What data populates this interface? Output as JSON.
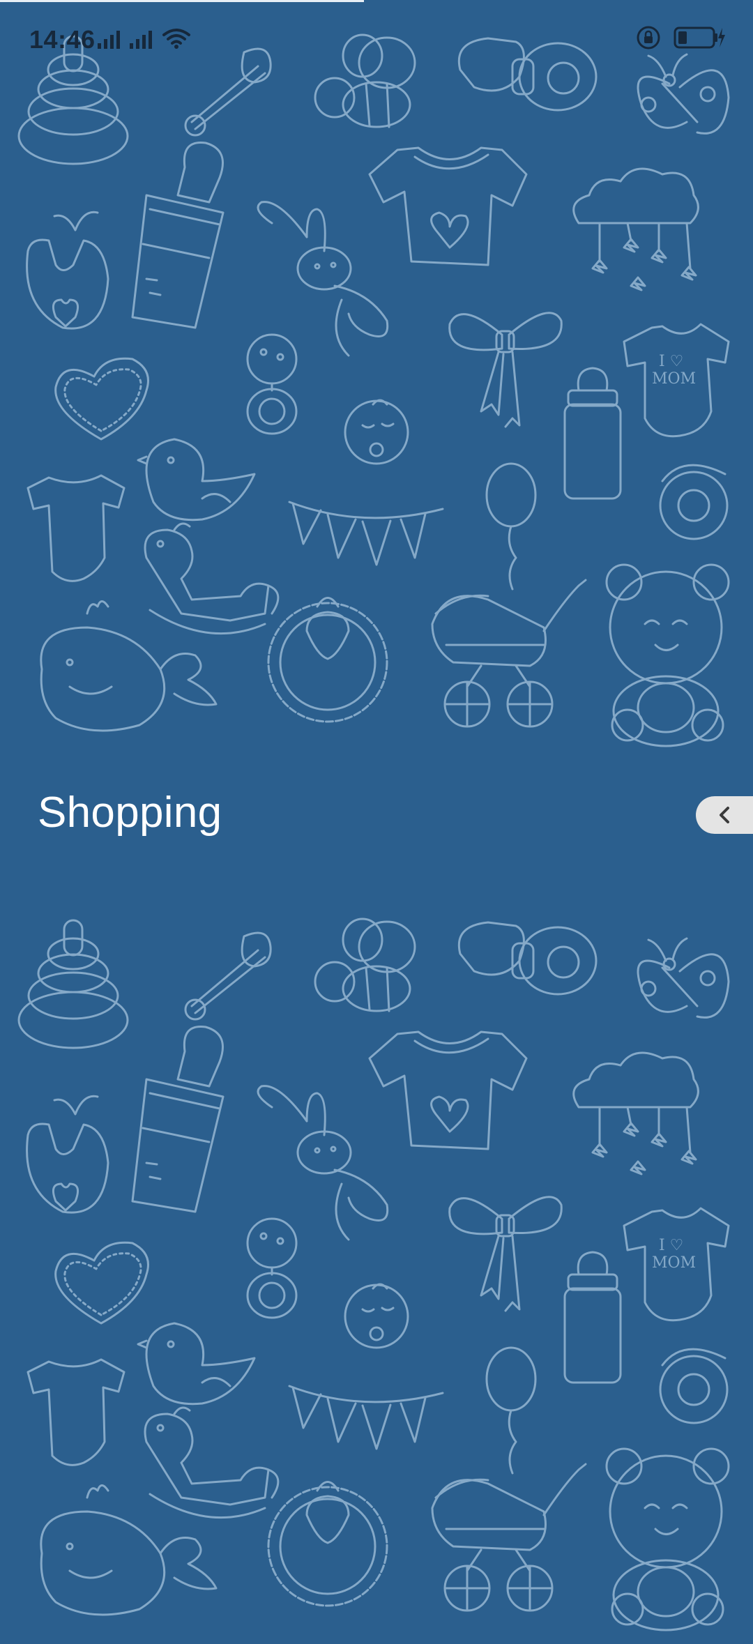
{
  "status_bar": {
    "time": "14:46",
    "icons": [
      "signal-icon",
      "signal-icon",
      "wifi-icon",
      "rotation-lock-icon",
      "battery-charging-icon"
    ]
  },
  "page": {
    "title": "Shopping"
  },
  "drawer_handle": {
    "icon": "chevron-left-icon"
  },
  "background": {
    "color": "#2b5f8e",
    "doodle_color": "#8fb2cf",
    "motifs": [
      "stacking-rings-icon",
      "safety-pin-icon",
      "bee-icon",
      "pacifier-icon",
      "butterfly-icon",
      "bib-icon",
      "baby-bottle-icon",
      "bunny-icon",
      "baby-tshirt-icon",
      "cloud-mobile-icon",
      "heart-icon",
      "rattle-icon",
      "bow-icon",
      "onesie-icon",
      "baby-face-icon",
      "bird-icon",
      "bunting-icon",
      "balloon-icon",
      "rocking-horse-icon",
      "whale-icon",
      "stroller-icon",
      "teddy-bear-icon"
    ]
  }
}
